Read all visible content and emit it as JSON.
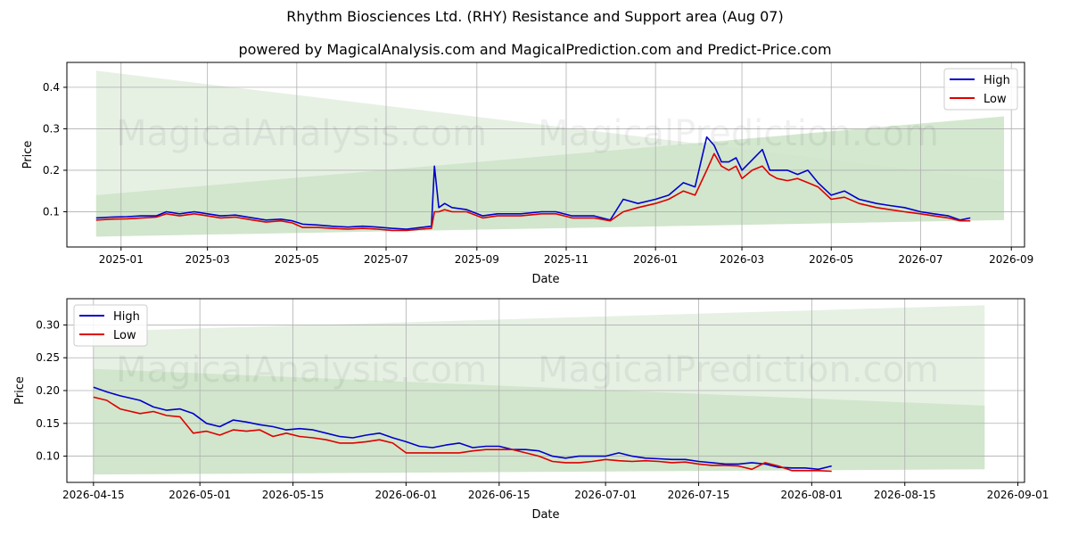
{
  "title": "Rhythm Biosciences Ltd. (RHY) Resistance and Support area (Aug 07)",
  "subtitle": "powered by MagicalAnalysis.com and MagicalPrediction.com and Predict-Price.com",
  "watermarks": [
    "MagicalAnalysis.com",
    "MagicalPrediction.com"
  ],
  "colors": {
    "high": "#0000cc",
    "low": "#dd0000",
    "band_outer": "#e6f1e4",
    "band_inner": "#cde4c8",
    "grid": "#b0b0b0"
  },
  "chart_data": [
    {
      "type": "line",
      "xlabel": "Date",
      "ylabel": "Price",
      "xlim": [
        "2024-11-25",
        "2026-09-10"
      ],
      "ylim": [
        0.015,
        0.46
      ],
      "x_ticks": [
        "2025-01",
        "2025-03",
        "2025-05",
        "2025-07",
        "2025-09",
        "2025-11",
        "2026-01",
        "2026-03",
        "2026-05",
        "2026-07",
        "2026-09"
      ],
      "y_ticks": [
        0.1,
        0.2,
        0.3,
        0.4
      ],
      "y_tick_labels": [
        "0.1",
        "0.2",
        "0.3",
        "0.4"
      ],
      "grid": true,
      "legend": "top-right",
      "bands": [
        {
          "x": [
            "2024-12-15",
            "2026-08-27"
          ],
          "upper": [
            0.44,
            0.175
          ],
          "lower": [
            0.04,
            0.08
          ]
        },
        {
          "x": [
            "2024-12-15",
            "2026-08-27"
          ],
          "upper": [
            0.14,
            0.33
          ],
          "lower": [
            0.04,
            0.08
          ]
        }
      ],
      "x": [
        "2024-12-15",
        "2024-12-25",
        "2025-01-05",
        "2025-01-15",
        "2025-01-25",
        "2025-02-01",
        "2025-02-10",
        "2025-02-20",
        "2025-03-01",
        "2025-03-10",
        "2025-03-20",
        "2025-04-01",
        "2025-04-10",
        "2025-04-20",
        "2025-04-28",
        "2025-05-05",
        "2025-05-15",
        "2025-05-25",
        "2025-06-05",
        "2025-06-15",
        "2025-06-25",
        "2025-07-05",
        "2025-07-15",
        "2025-07-25",
        "2025-08-01",
        "2025-08-03",
        "2025-08-06",
        "2025-08-10",
        "2025-08-15",
        "2025-08-25",
        "2025-09-05",
        "2025-09-15",
        "2025-10-01",
        "2025-10-15",
        "2025-10-25",
        "2025-11-05",
        "2025-11-20",
        "2025-12-01",
        "2025-12-10",
        "2025-12-20",
        "2026-01-01",
        "2026-01-10",
        "2026-01-20",
        "2026-01-28",
        "2026-02-05",
        "2026-02-10",
        "2026-02-15",
        "2026-02-20",
        "2026-02-25",
        "2026-03-01",
        "2026-03-08",
        "2026-03-15",
        "2026-03-20",
        "2026-03-25",
        "2026-04-01",
        "2026-04-08",
        "2026-04-15",
        "2026-04-22",
        "2026-05-01",
        "2026-05-10",
        "2026-05-20",
        "2026-06-01",
        "2026-06-10",
        "2026-06-20",
        "2026-07-01",
        "2026-07-10",
        "2026-07-20",
        "2026-07-28",
        "2026-08-04"
      ],
      "series": [
        {
          "name": "High",
          "values": [
            0.085,
            0.087,
            0.088,
            0.09,
            0.09,
            0.1,
            0.095,
            0.1,
            0.095,
            0.09,
            0.092,
            0.085,
            0.08,
            0.082,
            0.078,
            0.07,
            0.068,
            0.065,
            0.063,
            0.065,
            0.063,
            0.06,
            0.058,
            0.062,
            0.065,
            0.21,
            0.11,
            0.12,
            0.11,
            0.105,
            0.09,
            0.095,
            0.095,
            0.1,
            0.1,
            0.09,
            0.09,
            0.08,
            0.13,
            0.12,
            0.13,
            0.14,
            0.17,
            0.16,
            0.28,
            0.26,
            0.22,
            0.22,
            0.23,
            0.2,
            0.225,
            0.25,
            0.2,
            0.2,
            0.2,
            0.19,
            0.2,
            0.17,
            0.14,
            0.15,
            0.13,
            0.12,
            0.115,
            0.11,
            0.1,
            0.095,
            0.09,
            0.08,
            0.085
          ]
        },
        {
          "name": "Low",
          "values": [
            0.08,
            0.082,
            0.083,
            0.085,
            0.087,
            0.095,
            0.09,
            0.095,
            0.09,
            0.085,
            0.087,
            0.08,
            0.075,
            0.078,
            0.073,
            0.062,
            0.062,
            0.06,
            0.058,
            0.06,
            0.058,
            0.055,
            0.055,
            0.058,
            0.06,
            0.1,
            0.1,
            0.105,
            0.1,
            0.1,
            0.085,
            0.09,
            0.09,
            0.095,
            0.095,
            0.085,
            0.085,
            0.078,
            0.1,
            0.11,
            0.12,
            0.13,
            0.15,
            0.14,
            0.2,
            0.24,
            0.21,
            0.2,
            0.21,
            0.18,
            0.2,
            0.21,
            0.19,
            0.18,
            0.175,
            0.18,
            0.17,
            0.16,
            0.13,
            0.135,
            0.12,
            0.11,
            0.105,
            0.1,
            0.095,
            0.09,
            0.085,
            0.078,
            0.078
          ]
        }
      ]
    },
    {
      "type": "line",
      "xlabel": "Date",
      "ylabel": "Price",
      "xlim": [
        "2026-04-11",
        "2026-09-02"
      ],
      "ylim": [
        0.06,
        0.34
      ],
      "x_ticks": [
        "2026-04-15",
        "2026-05-01",
        "2026-05-15",
        "2026-06-01",
        "2026-06-15",
        "2026-07-01",
        "2026-07-15",
        "2026-08-01",
        "2026-08-15",
        "2026-09-01"
      ],
      "y_ticks": [
        0.1,
        0.15,
        0.2,
        0.25,
        0.3
      ],
      "y_tick_labels": [
        "0.10",
        "0.15",
        "0.20",
        "0.25",
        "0.30"
      ],
      "grid": true,
      "legend": "top-left",
      "bands": [
        {
          "x": [
            "2026-04-15",
            "2026-08-27"
          ],
          "upper": [
            0.29,
            0.33
          ],
          "lower": [
            0.072,
            0.08
          ]
        },
        {
          "x": [
            "2026-04-15",
            "2026-08-27"
          ],
          "upper": [
            0.233,
            0.177
          ],
          "lower": [
            0.072,
            0.08
          ]
        }
      ],
      "x": [
        "2026-04-15",
        "2026-04-17",
        "2026-04-19",
        "2026-04-22",
        "2026-04-24",
        "2026-04-26",
        "2026-04-28",
        "2026-04-30",
        "2026-05-02",
        "2026-05-04",
        "2026-05-06",
        "2026-05-08",
        "2026-05-10",
        "2026-05-12",
        "2026-05-14",
        "2026-05-16",
        "2026-05-18",
        "2026-05-20",
        "2026-05-22",
        "2026-05-24",
        "2026-05-26",
        "2026-05-28",
        "2026-05-30",
        "2026-06-01",
        "2026-06-03",
        "2026-06-05",
        "2026-06-07",
        "2026-06-09",
        "2026-06-11",
        "2026-06-13",
        "2026-06-15",
        "2026-06-17",
        "2026-06-19",
        "2026-06-21",
        "2026-06-23",
        "2026-06-25",
        "2026-06-27",
        "2026-06-29",
        "2026-07-01",
        "2026-07-03",
        "2026-07-05",
        "2026-07-07",
        "2026-07-09",
        "2026-07-11",
        "2026-07-13",
        "2026-07-15",
        "2026-07-17",
        "2026-07-19",
        "2026-07-21",
        "2026-07-23",
        "2026-07-25",
        "2026-07-27",
        "2026-07-29",
        "2026-07-31",
        "2026-08-02",
        "2026-08-04"
      ],
      "series": [
        {
          "name": "High",
          "values": [
            0.205,
            0.198,
            0.192,
            0.185,
            0.175,
            0.17,
            0.172,
            0.165,
            0.15,
            0.145,
            0.155,
            0.152,
            0.148,
            0.145,
            0.14,
            0.142,
            0.14,
            0.135,
            0.13,
            0.128,
            0.132,
            0.135,
            0.128,
            0.122,
            0.115,
            0.113,
            0.117,
            0.12,
            0.113,
            0.115,
            0.115,
            0.11,
            0.11,
            0.108,
            0.1,
            0.097,
            0.1,
            0.1,
            0.1,
            0.105,
            0.1,
            0.097,
            0.096,
            0.095,
            0.095,
            0.092,
            0.09,
            0.088,
            0.088,
            0.09,
            0.088,
            0.083,
            0.082,
            0.082,
            0.08,
            0.085
          ]
        },
        {
          "name": "Low",
          "values": [
            0.19,
            0.185,
            0.172,
            0.165,
            0.168,
            0.162,
            0.16,
            0.135,
            0.138,
            0.132,
            0.14,
            0.138,
            0.14,
            0.13,
            0.135,
            0.13,
            0.128,
            0.125,
            0.12,
            0.12,
            0.122,
            0.125,
            0.12,
            0.105,
            0.105,
            0.105,
            0.105,
            0.105,
            0.108,
            0.11,
            0.11,
            0.11,
            0.105,
            0.1,
            0.092,
            0.09,
            0.09,
            0.092,
            0.095,
            0.093,
            0.092,
            0.093,
            0.092,
            0.09,
            0.091,
            0.088,
            0.086,
            0.086,
            0.085,
            0.08,
            0.09,
            0.085,
            0.078,
            0.078,
            0.078,
            0.077
          ]
        }
      ]
    }
  ]
}
